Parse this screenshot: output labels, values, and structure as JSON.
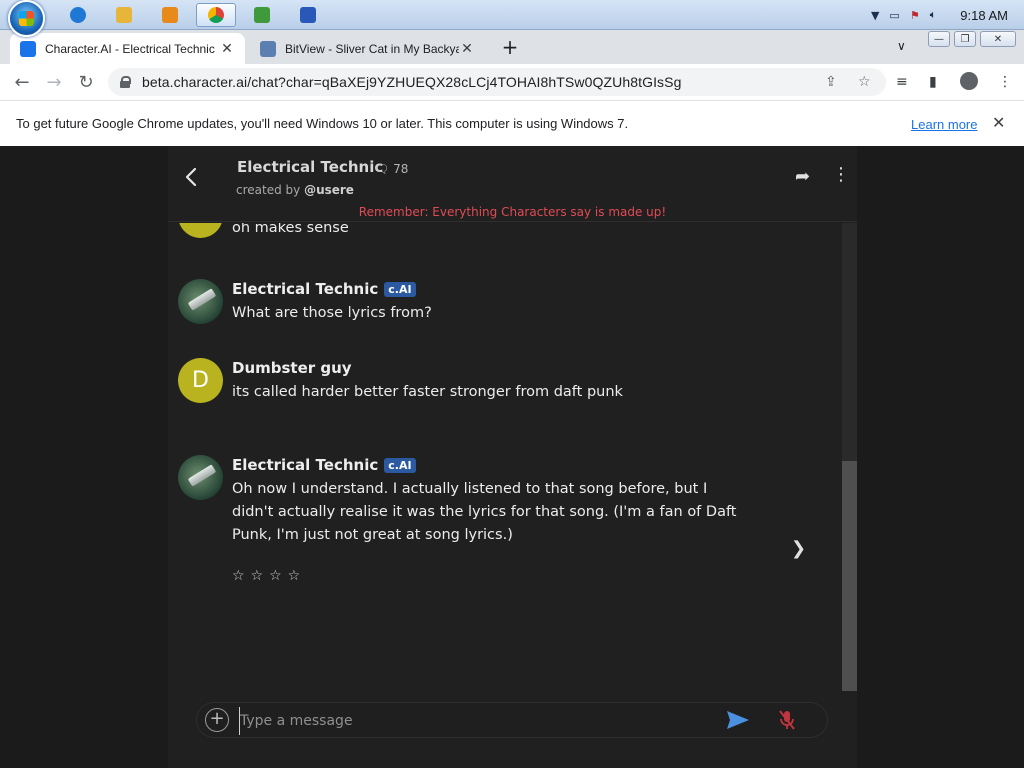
{
  "taskbar": {
    "clock": "9:18 AM",
    "apps": [
      {
        "name": "internet-explorer",
        "color": "#1e78d4"
      },
      {
        "name": "file-explorer",
        "color": "#e7b53a"
      },
      {
        "name": "media-player",
        "color": "#e88a1a"
      },
      {
        "name": "chrome",
        "color": "#db4437"
      },
      {
        "name": "green-app",
        "color": "#3f9a3c"
      },
      {
        "name": "vb-app",
        "color": "#2a58b8"
      }
    ]
  },
  "browser": {
    "tabs": [
      {
        "title": "Character.AI - Electrical Technic",
        "close": "✕"
      },
      {
        "title": "BitView - Sliver Cat in My Backyard",
        "close": "✕"
      }
    ],
    "new_tab": "+",
    "url": "beta.character.ai/chat?char=qBaXEj9YZHUEQX28cLCj4TOHAI8hTSw0QZUh8tGIsSg",
    "infobar_text": "To get future Google Chrome updates, you'll need Windows 10 or later. This computer is using Windows 7.",
    "learn_more": "Learn more",
    "infobar_close": "✕"
  },
  "chat": {
    "character_name": "Electrical Technic",
    "interactions": "78",
    "created_by_prefix": "created by ",
    "created_by_user": "@usere",
    "disclaimer": "Remember: Everything Characters say is made up!",
    "partial_message": "oh makes sense",
    "badge": "c.AI",
    "messages": [
      {
        "author": "Electrical Technic",
        "text": "What are those lyrics from?"
      },
      {
        "author": "Dumbster guy",
        "avatar_letter": "D",
        "text": "its called harder better faster stronger from daft punk"
      },
      {
        "author": "Electrical Technic",
        "text": "Oh now I understand. I actually listened to that song before, but I didn't actually realise it was the lyrics for that song. (I'm a fan of Daft Punk, I'm just not great at song lyrics.)"
      }
    ],
    "rating_stars": "☆☆☆☆",
    "rating_value": 0,
    "composer_placeholder": "Type a message"
  }
}
